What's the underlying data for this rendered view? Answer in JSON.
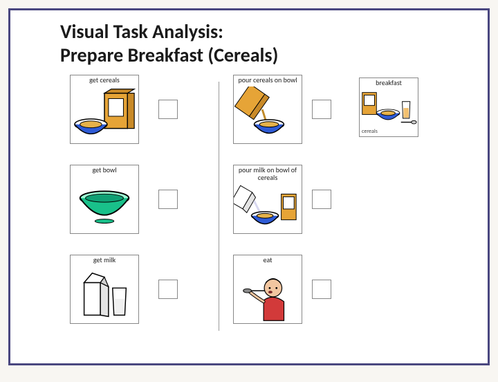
{
  "title_line1": "Visual Task Analysis:",
  "title_line2": "Prepare Breakfast (Cereals)",
  "steps": {
    "s1": {
      "label": "get cereals"
    },
    "s2": {
      "label": "get bowl"
    },
    "s3": {
      "label": "get milk"
    },
    "s4": {
      "label": "pour cereals on bowl"
    },
    "s5": {
      "label": "pour milk on bowl of cereals"
    },
    "s6": {
      "label": "eat"
    }
  },
  "result": {
    "label": "breakfast",
    "sublabel": "cereals"
  }
}
